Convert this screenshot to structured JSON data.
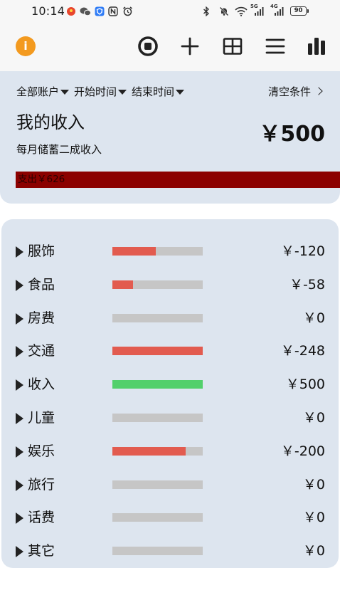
{
  "status_bar": {
    "time": "10:14",
    "network_1": "5G",
    "network_2": "4G",
    "battery_level": "90",
    "icons": [
      "app-notification-icon",
      "wechat-icon",
      "shield-app-icon",
      "nfc-icon",
      "alarm-icon",
      "bluetooth-icon",
      "mute-icon",
      "wifi-icon",
      "signal-icon",
      "battery-icon"
    ]
  },
  "toolbar": {
    "info_glyph": "i",
    "icons": [
      "info-icon",
      "stop-icon",
      "plus-icon",
      "grid-icon",
      "menu-icon",
      "bar-chart-icon"
    ]
  },
  "filters": {
    "account": "全部账户",
    "start_time": "开始时间",
    "end_time": "结束时间",
    "clear": "清空条件"
  },
  "summary": {
    "title": "我的收入",
    "subtitle": "每月储蓄二成收入",
    "amount": "￥500",
    "expense_label": "支出￥626",
    "expense_fill": 1.0
  },
  "categories": [
    {
      "name": "服饰",
      "amount": "￥-120",
      "fill": 0.48,
      "bar_color": "#e25b4f"
    },
    {
      "name": "食品",
      "amount": "￥-58",
      "fill": 0.23,
      "bar_color": "#e25b4f"
    },
    {
      "name": "房费",
      "amount": "￥0",
      "fill": 0,
      "bar_color": "#e25b4f"
    },
    {
      "name": "交通",
      "amount": "￥-248",
      "fill": 1.0,
      "bar_color": "#e25b4f"
    },
    {
      "name": "收入",
      "amount": "￥500",
      "fill": 1.0,
      "bar_color": "#52d06b"
    },
    {
      "name": "儿童",
      "amount": "￥0",
      "fill": 0,
      "bar_color": "#e25b4f"
    },
    {
      "name": "娱乐",
      "amount": "￥-200",
      "fill": 0.81,
      "bar_color": "#e25b4f"
    },
    {
      "name": "旅行",
      "amount": "￥0",
      "fill": 0,
      "bar_color": "#e25b4f"
    },
    {
      "name": "话费",
      "amount": "￥0",
      "fill": 0,
      "bar_color": "#e25b4f"
    },
    {
      "name": "其它",
      "amount": "￥0",
      "fill": 0,
      "bar_color": "#e25b4f"
    }
  ],
  "colors": {
    "accent": "#f39a1f",
    "card_background": "#dde5ef",
    "expense_bar": "#8b0000",
    "bar_track": "#c6c6c6",
    "expense_fill": "#e25b4f",
    "income_fill": "#52d06b"
  }
}
